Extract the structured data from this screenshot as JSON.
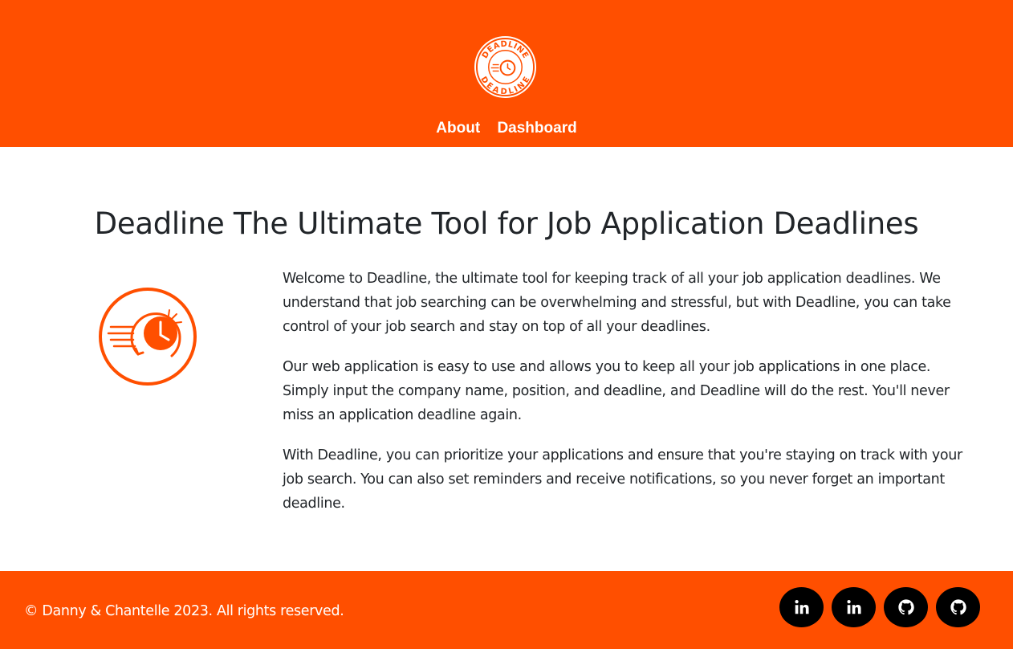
{
  "brand": {
    "logo_text_top": "DEADLINE",
    "logo_text_bottom": "DEADLINE",
    "color": "#ff4f00"
  },
  "nav": {
    "items": [
      {
        "label": "About"
      },
      {
        "label": "Dashboard"
      }
    ]
  },
  "main": {
    "title": "Deadline The Ultimate Tool for Job Application Deadlines",
    "icon": "deadline-clock-icon",
    "paragraphs": [
      "Welcome to Deadline, the ultimate tool for keeping track of all your job application deadlines. We understand that job searching can be overwhelming and stressful, but with Deadline, you can take control of your job search and stay on top of all your deadlines.",
      "Our web application is easy to use and allows you to keep all your job applications in one place. Simply input the company name, position, and deadline, and Deadline will do the rest. You'll never miss an application deadline again.",
      "With Deadline, you can prioritize your applications and ensure that you're staying on track with your job search. You can also set reminders and receive notifications, so you never forget an important deadline."
    ]
  },
  "footer": {
    "copyright": "© Danny & Chantelle 2023. All rights reserved.",
    "social": [
      {
        "icon": "linkedin-icon"
      },
      {
        "icon": "linkedin-icon"
      },
      {
        "icon": "github-icon"
      },
      {
        "icon": "github-icon"
      }
    ]
  }
}
